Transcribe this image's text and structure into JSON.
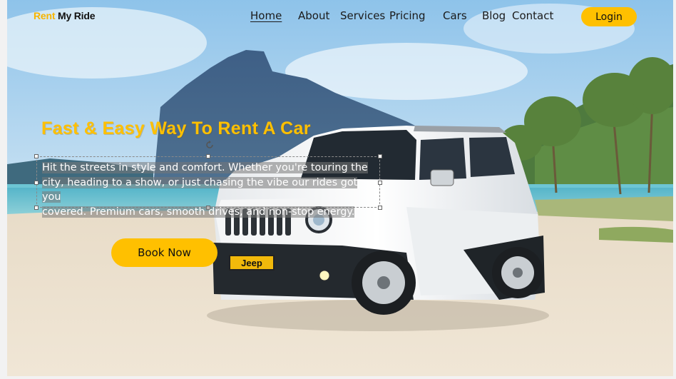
{
  "brand": {
    "part1": "Rent",
    "part2": "My Ride",
    "accent": "#ffc000"
  },
  "nav": {
    "home": "Home",
    "about": "About",
    "services": "Services",
    "pricing": "Pricing",
    "cars": "Cars",
    "blog": "Blog",
    "contact": "Contact"
  },
  "login_label": "Login",
  "hero": {
    "headline": "Fast & Easy Way To Rent A Car",
    "body_lines": [
      "Hit the streets in style and comfort. Whether you're touring the",
      "city, heading to a show, or just chasing the vibe our rides got you",
      "covered. Premium cars, smooth drives, and non-stop energy."
    ],
    "cta": "Book Now"
  },
  "car": {
    "badge": "Jeep"
  },
  "icons": {
    "rotate_handle": "rotate-icon"
  }
}
